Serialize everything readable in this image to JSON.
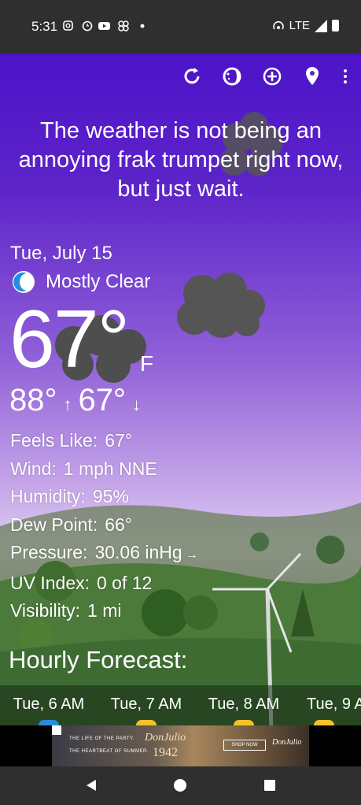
{
  "status_bar": {
    "time": "5:31",
    "network": "LTE",
    "left_icons": [
      "instagram-icon",
      "alarm-icon",
      "youtube-icon",
      "pinwheel-icon",
      "dot-icon"
    ]
  },
  "toolbar": {
    "icons": [
      "refresh-icon",
      "theme-icon",
      "add-location-icon",
      "location-pin-icon",
      "more-icon"
    ]
  },
  "weather": {
    "headline": "The weather is not being an annoying frak trumpet right now, but just wait.",
    "date": "Tue, July 15",
    "condition": "Mostly Clear",
    "temperature": "67°",
    "unit": "F",
    "high": "88°",
    "high_arrow": "↑",
    "low": "67°",
    "low_arrow": "↓"
  },
  "details": {
    "feels_like_label": "Feels Like:",
    "feels_like": "67°",
    "wind_label": "Wind:",
    "wind": "1 mph NNE",
    "humidity_label": "Humidity:",
    "humidity": "95%",
    "dew_point_label": "Dew Point:",
    "dew_point": "66°",
    "pressure_label": "Pressure:",
    "pressure": "30.06 inHg",
    "pressure_trend": "→",
    "uv_label": "UV Index:",
    "uv": "0 of 12",
    "visibility_label": "Visibility:",
    "visibility": "1 mi"
  },
  "hourly": {
    "title": "Hourly Forecast:",
    "items": [
      {
        "label": "Tue, 6 AM",
        "color": "#2a8bd8"
      },
      {
        "label": "Tue, 7 AM",
        "color": "#f5c02b"
      },
      {
        "label": "Tue, 8 AM",
        "color": "#f5c02b"
      },
      {
        "label": "Tue, 9 A",
        "color": "#f5c02b"
      }
    ]
  },
  "ad": {
    "line1": "THE LIFE OF THE PARTY.",
    "line2": "THE HEARTBEAT OF SUMMER.",
    "brand": "DonJulio",
    "year": "1942",
    "cta": "SHOP NOW",
    "brand2": "DonJulio"
  },
  "colors": {
    "sky_top": "#4c13c9",
    "sky_mid": "#c7a8e9",
    "grass": "#3e6b32",
    "cloud": "#555555"
  }
}
